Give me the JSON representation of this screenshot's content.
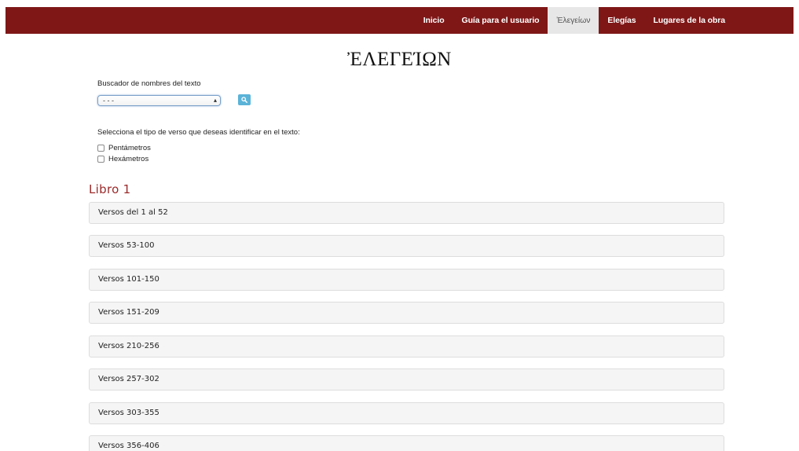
{
  "nav": {
    "items": [
      {
        "label": "Inicio",
        "active": false
      },
      {
        "label": "Guía para el usuario",
        "active": false
      },
      {
        "label": "Ἐλεγείων",
        "active": true
      },
      {
        "label": "Elegías",
        "active": false
      },
      {
        "label": "Lugares de la obra",
        "active": false
      }
    ]
  },
  "title": "ἘΛΕΓΕΊΩΝ",
  "search": {
    "label": "Buscador de nombres del texto",
    "selected": "- - -",
    "button_icon": "search-icon"
  },
  "verse_filter": {
    "label": "Selecciona el tipo de verso que deseas identificar en el texto:",
    "options": [
      {
        "label": "Pentámetros",
        "checked": false
      },
      {
        "label": "Hexámetros",
        "checked": false
      }
    ]
  },
  "book": {
    "title": "Libro 1",
    "sections": [
      "Versos del 1 al 52",
      "Versos 53-100",
      "Versos 101-150",
      "Versos 151-209",
      "Versos 210-256",
      "Versos 257-302",
      "Versos 303-355",
      "Versos 356-406"
    ]
  },
  "colors": {
    "navbar": "#7f1717",
    "book_title": "#9b2a2a",
    "search_button": "#5bb3d8"
  }
}
